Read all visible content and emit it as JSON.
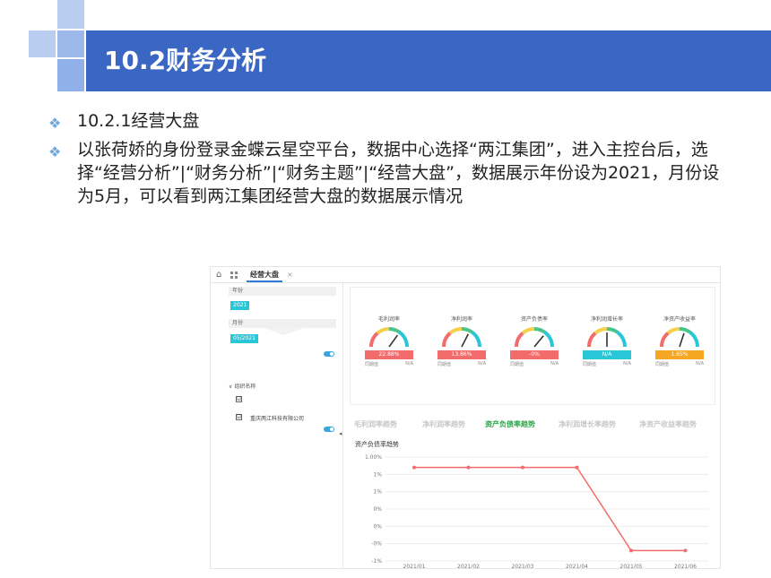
{
  "slide": {
    "title": "10.2财务分析",
    "bullets": [
      "10.2.1经营大盘",
      " 以张荷娇的身份登录金蝶云星空平台，数据中心选择“两江集团”，进入主控台后，选择“经营分析”|“财务分析”|“财务主题”|“经营大盘”，数据展示年份设为2021，月份设为5月，可以看到两江集团经营大盘的数据展示情况"
    ],
    "bullet_symbol": "❖"
  },
  "screenshot": {
    "tab": {
      "label": "经营大盘",
      "close": "×"
    },
    "filters": {
      "year_label": "年份",
      "year_value": "2021",
      "month_label": "月份",
      "month_value": "05/2021",
      "org_label": "组织名称",
      "org_company": "重庆两江科技有限公司",
      "org_arrow": "∨",
      "check_mark": "☑"
    },
    "gauges": [
      {
        "title": "毛利润率",
        "value": "22.88%",
        "color": "#f36c6c",
        "foot_left": "同期值",
        "foot_right": "N/A",
        "needle": 0.7
      },
      {
        "title": "净利润率",
        "value": "13.86%",
        "color": "#f36c6c",
        "foot_left": "同期值",
        "foot_right": "N/A",
        "needle": 0.65
      },
      {
        "title": "资产负债率",
        "value": "-0%",
        "color": "#f36c6c",
        "foot_left": "同期值",
        "foot_right": "N/A",
        "needle": 0.72
      },
      {
        "title": "净利润增长率",
        "value": "N/A",
        "color": "#29c6d8",
        "foot_left": "同期值",
        "foot_right": "N/A",
        "needle": 0.5
      },
      {
        "title": "净资产收益率",
        "value": "1.65%",
        "color": "#f5a623",
        "foot_left": "同期值",
        "foot_right": "N/A",
        "needle": 0.6
      }
    ],
    "subtabs": [
      "毛利润率趋势",
      "净利润率趋势",
      "资产负债率趋势",
      "净利润增长率趋势",
      "净资产收益率趋势"
    ],
    "active_subtab": 2,
    "collapse_icon": "◂"
  },
  "chart_data": {
    "type": "line",
    "title": "资产负债率趋势",
    "categories": [
      "2021/01",
      "2021/02",
      "2021/03",
      "2021/04",
      "2021/05",
      "2021/06"
    ],
    "y_tick_labels": [
      "1.00%",
      "1%",
      "1%",
      "0%",
      "0%",
      "-0%",
      "-1%"
    ],
    "series": [
      {
        "values": [
          0.8,
          0.8,
          0.8,
          0.8,
          -0.8,
          -0.8
        ],
        "color": "#f36c6c"
      }
    ],
    "ylim": [
      -1,
      1
    ],
    "grid": true
  },
  "colors": {
    "title_bar": "#3a66c4",
    "accent": "#2aa846"
  }
}
